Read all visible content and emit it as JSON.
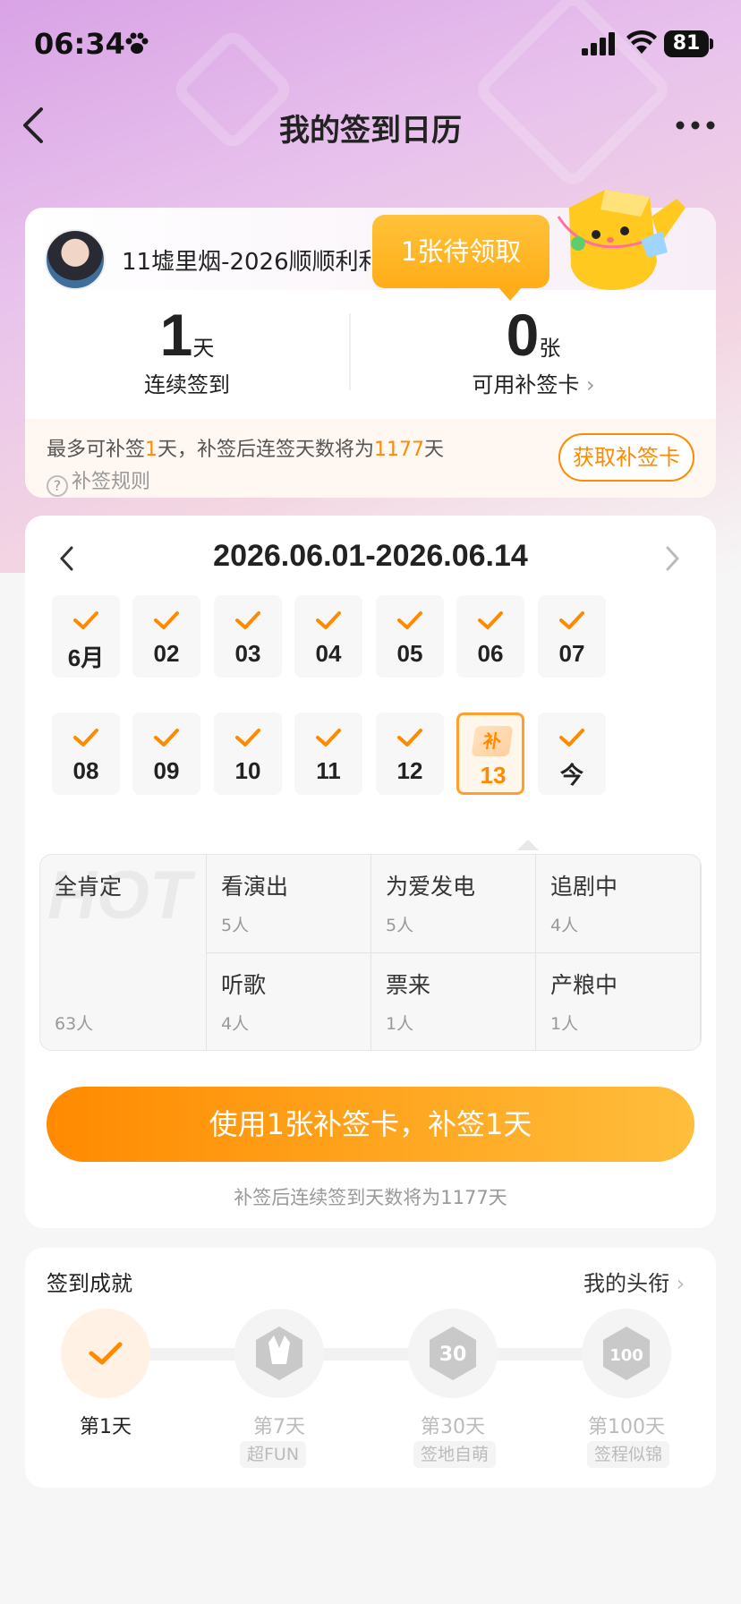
{
  "status": {
    "time": "06:34",
    "battery": "81"
  },
  "nav": {
    "title": "我的签到日历"
  },
  "profile": {
    "username": "11墟里烟-2026顺顺利利",
    "streak_num": "1",
    "streak_unit": "天",
    "streak_label": "连续签到",
    "cards_num": "0",
    "cards_unit": "张",
    "cards_label": "可用补签卡",
    "tooltip": "1张待领取",
    "tip_pre": "最多可补签",
    "tip_days": "1",
    "tip_mid": "天，补签后连签天数将为",
    "tip_total": "1177",
    "tip_post": "天",
    "rule_label": "补签规则",
    "get_card_label": "获取补签卡"
  },
  "calendar": {
    "range": "2026.06.01-2026.06.14",
    "days": [
      {
        "label": "6月",
        "state": "checked"
      },
      {
        "label": "02",
        "state": "checked"
      },
      {
        "label": "03",
        "state": "checked"
      },
      {
        "label": "04",
        "state": "checked"
      },
      {
        "label": "05",
        "state": "checked"
      },
      {
        "label": "06",
        "state": "checked"
      },
      {
        "label": "07",
        "state": "checked"
      },
      {
        "label": "08",
        "state": "checked"
      },
      {
        "label": "09",
        "state": "checked"
      },
      {
        "label": "10",
        "state": "checked"
      },
      {
        "label": "11",
        "state": "checked"
      },
      {
        "label": "12",
        "state": "checked"
      },
      {
        "label": "13",
        "state": "makeup",
        "tag": "补"
      },
      {
        "label": "今",
        "state": "checked"
      }
    ]
  },
  "tags": {
    "watermark": "HOT",
    "featured": {
      "title": "全肯定",
      "count": "63人"
    },
    "items": [
      {
        "title": "看演出",
        "count": "5人"
      },
      {
        "title": "为爱发电",
        "count": "5人"
      },
      {
        "title": "追剧中",
        "count": "4人"
      },
      {
        "title": "听歌",
        "count": "4人"
      },
      {
        "title": "票来",
        "count": "1人"
      },
      {
        "title": "产粮中",
        "count": "1人"
      }
    ]
  },
  "action": {
    "button_label": "使用1张补签卡，补签1天",
    "note": "补签后连续签到天数将为1177天"
  },
  "achievements": {
    "title": "签到成就",
    "link_label": "我的头衔",
    "items": [
      {
        "label": "第1天",
        "sub": "",
        "active": true
      },
      {
        "label": "第7天",
        "sub": "超FUN",
        "active": false
      },
      {
        "label": "第30天",
        "sub": "签地自萌",
        "active": false
      },
      {
        "label": "第100天",
        "sub": "签程似锦",
        "active": false
      }
    ]
  },
  "colors": {
    "accent": "#ff8a00",
    "accent_light": "#ffbe3c"
  }
}
